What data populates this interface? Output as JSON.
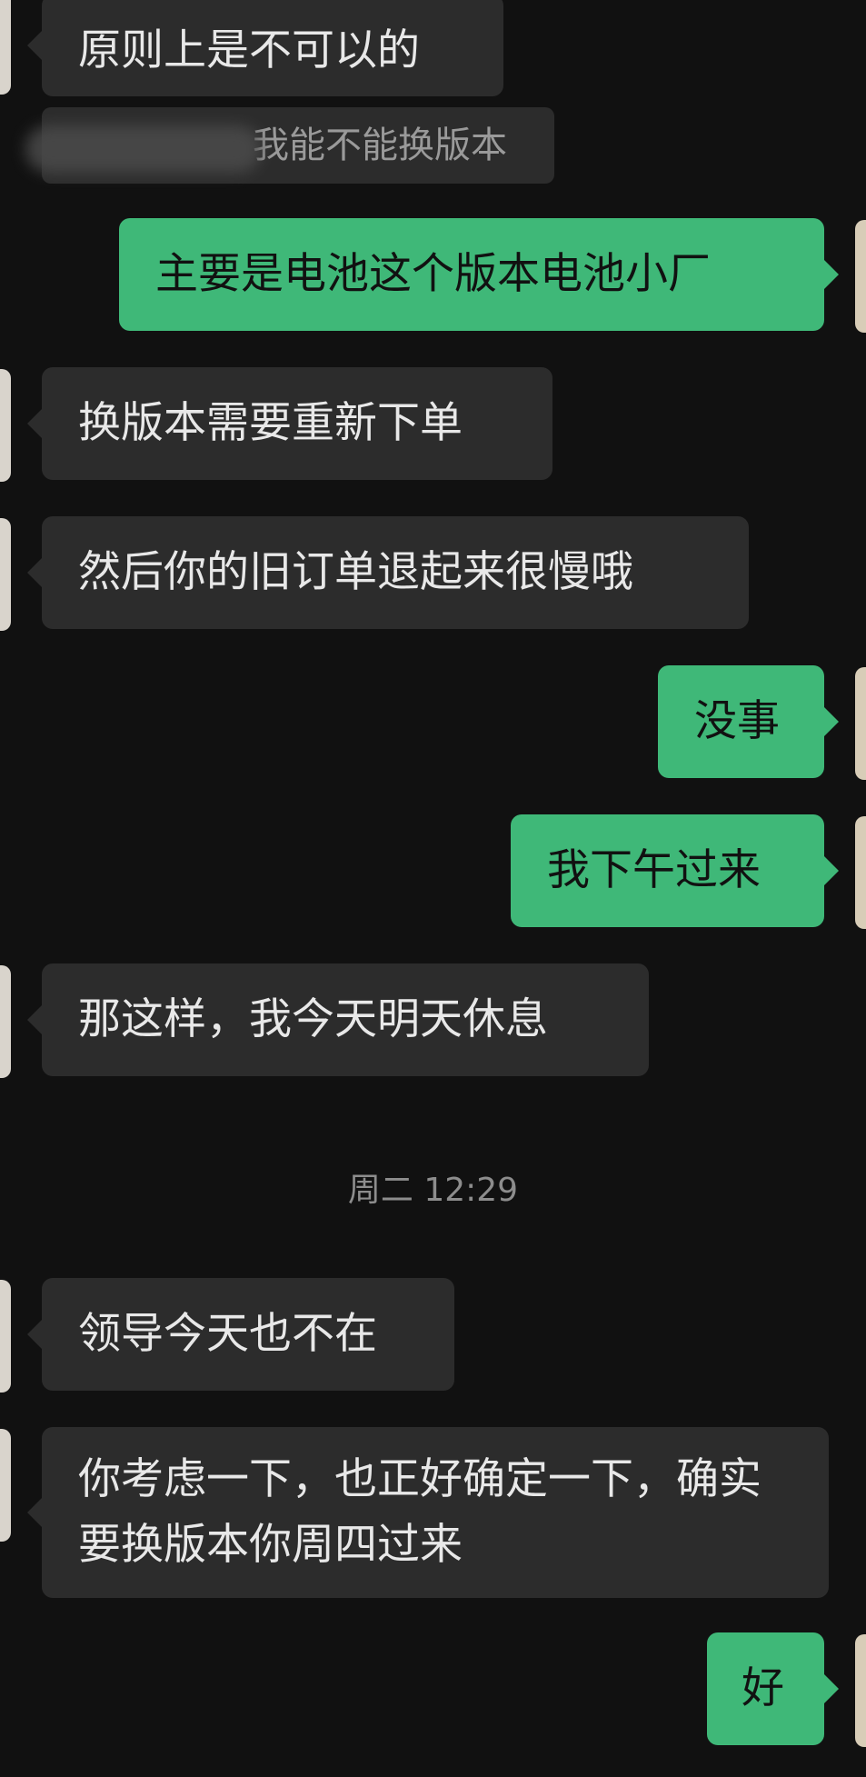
{
  "messages": [
    {
      "side": "left",
      "text": "原则上是不可以的"
    },
    {
      "side": "quote",
      "text": "我能不能换版本"
    },
    {
      "side": "right",
      "text": "主要是电池这个版本电池小厂"
    },
    {
      "side": "left",
      "text": "换版本需要重新下单"
    },
    {
      "side": "left",
      "text": "然后你的旧订单退起来很慢哦"
    },
    {
      "side": "right",
      "text": "没事"
    },
    {
      "side": "right",
      "text": "我下午过来"
    },
    {
      "side": "left",
      "text": "那这样，我今天明天休息"
    },
    {
      "side": "time",
      "text": "周二 12:29"
    },
    {
      "side": "left",
      "text": "领导今天也不在"
    },
    {
      "side": "left",
      "text": "你考虑一下，也正好确定一下，确实要换版本你周四过来"
    },
    {
      "side": "right",
      "text": "好"
    }
  ]
}
